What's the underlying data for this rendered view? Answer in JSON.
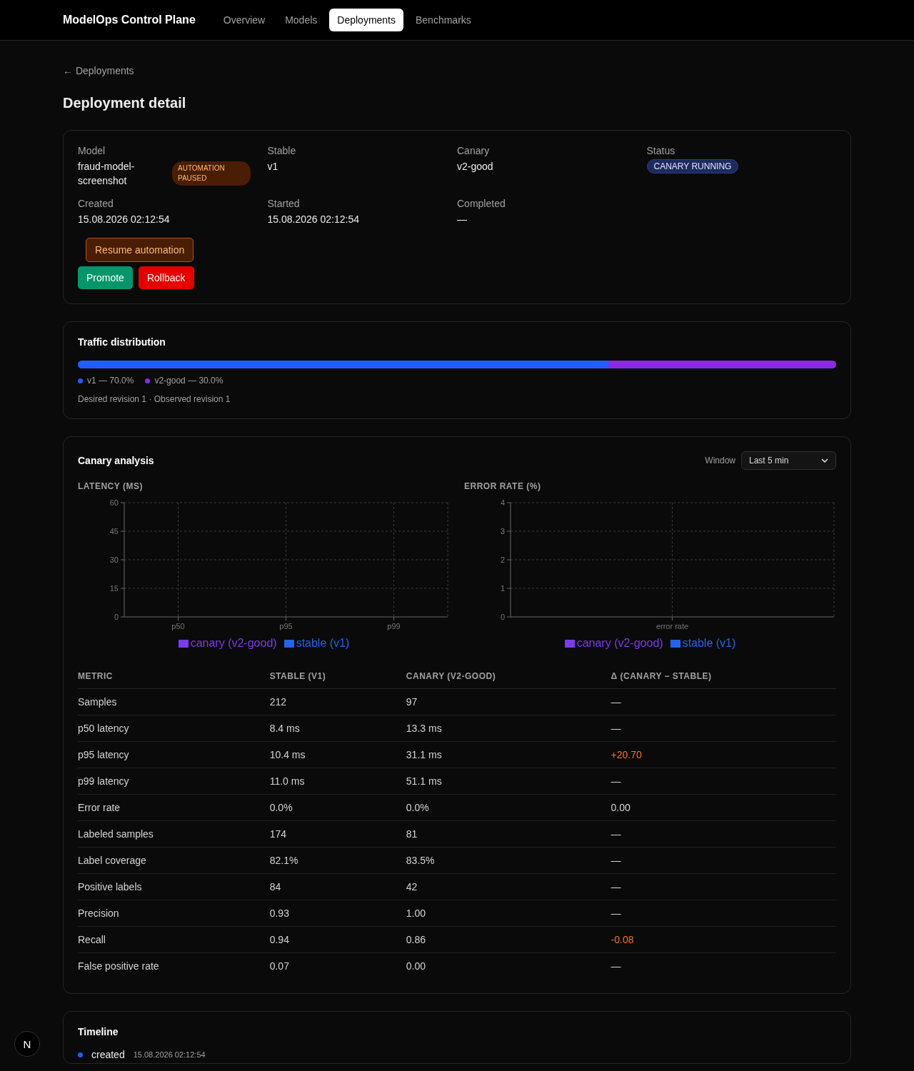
{
  "nav": {
    "brand": "ModelOps Control Plane",
    "tabs": [
      {
        "label": "Overview",
        "selected": false
      },
      {
        "label": "Models",
        "selected": false
      },
      {
        "label": "Deployments",
        "selected": true
      },
      {
        "label": "Benchmarks",
        "selected": false
      }
    ]
  },
  "back_link": {
    "arrow": "←",
    "label": "Deployments"
  },
  "page_title": "Deployment detail",
  "summary": {
    "fields": [
      {
        "label": "Model",
        "value": "fraud-model-screenshot",
        "badge": "AUTOMATION PAUSED",
        "kind": "badge"
      },
      {
        "label": "Stable",
        "value": "v1",
        "kind": "text"
      },
      {
        "label": "Canary",
        "value": "v2-good",
        "kind": "text"
      },
      {
        "label": "Status",
        "value": "CANARY RUNNING",
        "kind": "status"
      },
      {
        "label": "Created",
        "value": "15.08.2026 02:12:54",
        "kind": "text"
      },
      {
        "label": "Started",
        "value": "15.08.2026 02:12:54",
        "kind": "text"
      },
      {
        "label": "Completed",
        "value": "—",
        "kind": "text"
      }
    ],
    "resume_button": "Resume automation",
    "buttons": [
      {
        "label": "Promote",
        "kind": "promote"
      },
      {
        "label": "Rollback",
        "kind": "rollback"
      }
    ]
  },
  "traffic": {
    "title": "Traffic distribution",
    "segments": [
      {
        "label": "v1 — 70.0%",
        "level": 0.7,
        "color": "#1f5fff"
      },
      {
        "label": "v2-good — 30.0%",
        "level": 0.3,
        "color": "#8a2be2"
      }
    ],
    "revision_note": "Desired revision 1 · Observed revision 1"
  },
  "analysis": {
    "title": "Canary analysis",
    "window_label": "Window",
    "window_value": "Last 5 min",
    "charts": [
      {
        "chart_data": {
          "type": "bar",
          "grid": true,
          "title": "LATENCY (MS)",
          "categories": [
            "p50",
            "p95",
            "p99"
          ],
          "ylim": [
            0,
            60
          ],
          "yticks": [
            0,
            15,
            30,
            45,
            60
          ],
          "series": [
            {
              "name": "canary (v2-good)",
              "color": "#7c3aed",
              "values": [
                null,
                null,
                null
              ]
            },
            {
              "name": "stable (v1)",
              "color": "#2563eb",
              "values": [
                null,
                null,
                null
              ]
            }
          ]
        }
      },
      {
        "chart_data": {
          "type": "bar",
          "grid": true,
          "title": "ERROR RATE (%)",
          "categories": [
            "error rate"
          ],
          "ylim": [
            0,
            4
          ],
          "yticks": [
            0,
            1,
            2,
            3,
            4
          ],
          "series": [
            {
              "name": "canary (v2-good)",
              "color": "#7c3aed",
              "values": [
                null
              ]
            },
            {
              "name": "stable (v1)",
              "color": "#2563eb",
              "values": [
                null
              ]
            }
          ]
        }
      }
    ],
    "table": {
      "columns": [
        "METRIC",
        "STABLE (V1)",
        "CANARY (V2-GOOD)",
        "Δ (CANARY − STABLE)"
      ],
      "rows": [
        {
          "metric": "Samples",
          "stable": "212",
          "canary": "97",
          "delta": "—",
          "flagged": false
        },
        {
          "metric": "p50 latency",
          "stable": "8.4 ms",
          "canary": "13.3 ms",
          "delta": "—",
          "flagged": false
        },
        {
          "metric": "p95 latency",
          "stable": "10.4 ms",
          "canary": "31.1 ms",
          "delta": "+20.70",
          "flagged": true
        },
        {
          "metric": "p99 latency",
          "stable": "11.0 ms",
          "canary": "51.1 ms",
          "delta": "—",
          "flagged": false
        },
        {
          "metric": "Error rate",
          "stable": "0.0%",
          "canary": "0.0%",
          "delta": "0.00",
          "flagged": false
        },
        {
          "metric": "Labeled samples",
          "stable": "174",
          "canary": "81",
          "delta": "—",
          "flagged": false
        },
        {
          "metric": "Label coverage",
          "stable": "82.1%",
          "canary": "83.5%",
          "delta": "—",
          "flagged": false
        },
        {
          "metric": "Positive labels",
          "stable": "84",
          "canary": "42",
          "delta": "—",
          "flagged": false
        },
        {
          "metric": "Precision",
          "stable": "0.93",
          "canary": "1.00",
          "delta": "—",
          "flagged": false
        },
        {
          "metric": "Recall",
          "stable": "0.94",
          "canary": "0.86",
          "delta": "-0.08",
          "flagged": true
        },
        {
          "metric": "False positive rate",
          "stable": "0.07",
          "canary": "0.00",
          "delta": "—",
          "flagged": false
        }
      ]
    }
  },
  "timeline": {
    "title": "Timeline",
    "events": [
      {
        "event": "created",
        "time": "15.08.2026 02:12:54",
        "color": "#1f5fff"
      }
    ]
  },
  "dev_badge": {
    "label": "N"
  }
}
